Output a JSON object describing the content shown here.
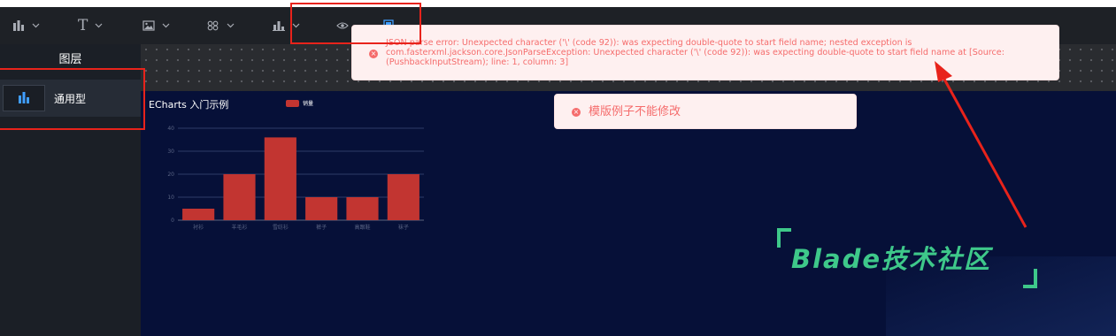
{
  "toolbar": {
    "items": [
      {
        "icon": "bar-chart-icon"
      },
      {
        "icon": "text-icon",
        "label": "T"
      },
      {
        "icon": "image-icon"
      },
      {
        "icon": "grid-icon"
      },
      {
        "icon": "bar-chart-icon"
      },
      {
        "icon": "eye-icon"
      },
      {
        "icon": "document-icon"
      }
    ]
  },
  "sidebar": {
    "title": "图层",
    "layers": [
      {
        "label": "通用型",
        "icon": "bar-chart-icon"
      }
    ]
  },
  "chart_data": {
    "type": "bar",
    "title": "ECharts 入门示例",
    "categories": [
      "衬衫",
      "羊毛衫",
      "雪纺衫",
      "裤子",
      "高跟鞋",
      "袜子"
    ],
    "series": [
      {
        "name": "销量",
        "values": [
          5,
          20,
          36,
          10,
          10,
          20
        ]
      }
    ],
    "yticks": [
      0,
      10,
      20,
      30,
      40
    ],
    "ylim": [
      0,
      40
    ],
    "grid": true,
    "legend_position": "top",
    "color": "#c23531"
  },
  "toasts": [
    {
      "icon": "error-circle-icon",
      "message": "JSON parse error: Unexpected character ('\\' (code 92)): was expecting double-quote to start field name; nested exception is com.fasterxml.jackson.core.JsonParseException: Unexpected character ('\\' (code 92)): was expecting double-quote to start field name at [Source: (PushbackInputStream); line: 1, column: 3]"
    },
    {
      "icon": "error-circle-icon",
      "message": "模版例子不能修改"
    }
  ],
  "watermark": {
    "text": "Blade技术社区"
  },
  "colors": {
    "toolbar_bg": "#1e2126",
    "canvas_bg": "#061038",
    "error": "#f56c6c",
    "annotation_red": "#e8231b",
    "watermark_green": "#3ec88a"
  }
}
